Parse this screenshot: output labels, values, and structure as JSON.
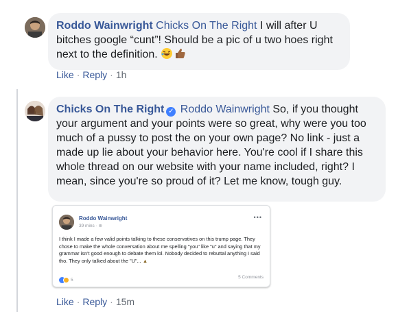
{
  "comment1": {
    "author": "Roddo Wainwright",
    "mention": "Chicks On The Right",
    "text": " I will after U bitches google “cunt”! Should be a pic of u two hoes right next to the definition. ",
    "emoji": [
      "rolling-on-floor-laughing",
      "thumbs-up"
    ],
    "actions": {
      "like": "Like",
      "reply": "Reply",
      "time": "1h"
    }
  },
  "comment2": {
    "author": "Chicks On The Right",
    "verified": "✓",
    "mention": "Roddo Wainwright",
    "text": " So, if you thought your argument and your points were so great, why were you too much of a pussy to post the on your own page? No link - just a made up lie about your behavior here. You're cool if I share this whole thread on our website with your name included, right? I mean, since you're so proud of it? Let me know, tough guy.",
    "actions": {
      "like": "Like",
      "reply": "Reply",
      "time": "15m"
    }
  },
  "attachment": {
    "name": "Roddo Wainwright",
    "time": "39 mins · ",
    "more": "•••",
    "text": "I think I made a few valid points talking to these conservatives on this trump page. They chose to make the whole conversation about me spelling \"you\" like \"u\" and saying that my grammar isn't good enough to debate them lol. Nobody decided to rebuttal anything I said tho. They only talked about the \"U\"...",
    "reactions_count": "5",
    "comments_count": "5 Comments"
  },
  "colors": {
    "link": "#385898",
    "bubble": "#f2f3f5",
    "meta": "#606770",
    "verified": "#4080ff"
  }
}
